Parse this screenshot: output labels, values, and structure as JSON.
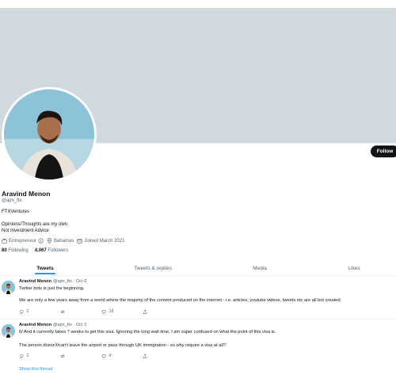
{
  "profile": {
    "follow_label": "Follow",
    "name": "Aravind Menon",
    "handle": "@ajm_ftx",
    "company": "FTXVentures",
    "bio_line1": "Opinions/Thoughts are my own",
    "bio_line2": "Not Investment Advice",
    "category": "Entrepreneur",
    "location": "Bahamas",
    "joined": "Joined March 2021",
    "following_count": "80",
    "following_label": "Following",
    "followers_count": "4,067",
    "followers_label": "Followers"
  },
  "tabs": [
    "Tweets",
    "Tweets & replies",
    "Media",
    "Likes"
  ],
  "active_tab": "Tweets",
  "colors": {
    "accent": "#1d9bf0",
    "banner": "#cfd9de",
    "follow_button": "#0f1419"
  },
  "tweets": [
    {
      "name": "Aravind Menon",
      "handle": "@ajm_ftx",
      "date": "· Oct 6",
      "text1": "Twitter bots is just the beginning.",
      "text2": "We are only a few years away from a world where the majority of the content produced on the internet - i.e. articles, youtube videos, tweets etc are all bot created.",
      "replies": "2",
      "retweets": "",
      "likes": "16"
    },
    {
      "name": "Aravind Menon",
      "handle": "@ajm_ftx",
      "date": "· Oct 2",
      "text1": "6/ And it currently takes 7 weeks to get this visa. Ignoring the long wait time, I am super confused on what the point of this visa is.",
      "text2": "The person doesn't/can't leave the airport or pass through UK immigration - so why require a visa at all?",
      "replies": "2",
      "retweets": "",
      "likes": "4",
      "show_thread": "Show this thread"
    }
  ],
  "icons": [
    "briefcase-icon",
    "info-icon",
    "location-pin-icon",
    "calendar-icon",
    "reply-icon",
    "retweet-icon",
    "like-icon",
    "share-icon"
  ]
}
